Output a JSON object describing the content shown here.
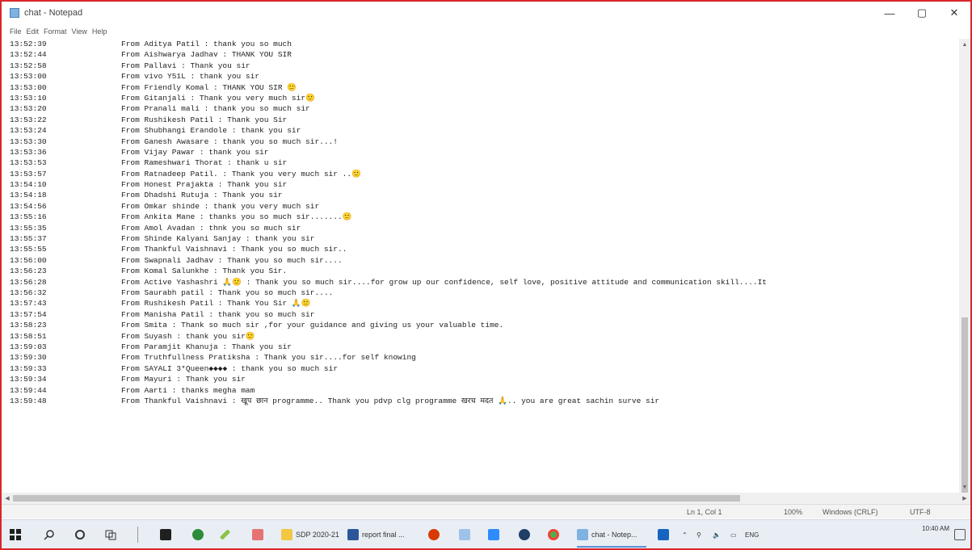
{
  "window": {
    "title": "chat - Notepad",
    "controls": {
      "minimize": "—",
      "maximize": "▢",
      "close": "✕"
    }
  },
  "menu": [
    "File",
    "Edit",
    "Format",
    "View",
    "Help"
  ],
  "chat_lines": [
    {
      "time": "13:52:39",
      "text": "From  Aditya Patil : thank you so much"
    },
    {
      "time": "13:52:44",
      "text": "From  Aishwarya Jadhav : THANK YOU SIR"
    },
    {
      "time": "13:52:58",
      "text": "From  Pallavi : Thank you sir"
    },
    {
      "time": "13:53:00",
      "text": "From  vivo Y51L : thank you sir"
    },
    {
      "time": "13:53:00",
      "text": "From  Friendly Komal : THANK YOU SIR 🙂"
    },
    {
      "time": "13:53:10",
      "text": "From  Gitanjali : Thank you very much sir🙂"
    },
    {
      "time": "13:53:20",
      "text": "From  Pranali mali : thank you so much sir"
    },
    {
      "time": "13:53:22",
      "text": "From  Rushikesh Patil : Thank you Sir"
    },
    {
      "time": "13:53:24",
      "text": "From  Shubhangi Erandole : thank you sir"
    },
    {
      "time": "13:53:30",
      "text": "From  Ganesh Awasare : thank you so much sir...!"
    },
    {
      "time": "13:53:36",
      "text": "From  Vijay Pawar : thank you sir"
    },
    {
      "time": "13:53:53",
      "text": "From  Rameshwari Thorat : thank u sir"
    },
    {
      "time": "13:53:57",
      "text": "From  Ratnadeep Patil. : Thank you very much sir  ..🙂"
    },
    {
      "time": "13:54:10",
      "text": "From  Honest Prajakta : Thank you sir"
    },
    {
      "time": "13:54:18",
      "text": "From  Dhadshi Rutuja : Thank you sir"
    },
    {
      "time": "13:54:56",
      "text": "From  Omkar shinde : thank you very much sir"
    },
    {
      "time": "13:55:16",
      "text": "From  Ankita Mane : thanks you so much sir.......🙂"
    },
    {
      "time": "13:55:35",
      "text": "From  Amol Avadan : thnk you so much sir"
    },
    {
      "time": "13:55:37",
      "text": "From  Shinde Kalyani Sanjay : thank you sir"
    },
    {
      "time": "13:55:55",
      "text": "From  Thankful Vaishnavi : Thank you so much sir.."
    },
    {
      "time": "13:56:00",
      "text": "From  Swapnali Jadhav : Thank you so much sir...."
    },
    {
      "time": "13:56:23",
      "text": "From  Komal  Salunkhe : Thank you Sir."
    },
    {
      "time": "13:56:28",
      "text": "From  Active Yashashri 🙏🙂 : Thank you so much sir....for grow up our confidence, self love, positive attitude and communication skill....It"
    },
    {
      "time": "13:56:32",
      "text": "From  Saurabh patil : Thank you so much sir...."
    },
    {
      "time": "13:57:43",
      "text": "From  Rushikesh Patil : Thank You Sir 🙏🙂"
    },
    {
      "time": "13:57:54",
      "text": "From  Manisha Patil : thank you so much sir"
    },
    {
      "time": "13:58:23",
      "text": "From  Smita : Thank so much sir ,for your guidance and giving us your valuable time."
    },
    {
      "time": "13:58:51",
      "text": "From  Suyash : thank you sir🙂"
    },
    {
      "time": "13:59:03",
      "text": "From  Paramjit Khanuja : Thank you sir"
    },
    {
      "time": "13:59:30",
      "text": "From  Truthfullness Pratiksha : Thank you sir....for self knowing"
    },
    {
      "time": "13:59:33",
      "text": "From  SAYALI 3*Queen◆◆◆◆ : thank you so much sir"
    },
    {
      "time": "13:59:34",
      "text": "From  Mayuri : Thank you sir"
    },
    {
      "time": "13:59:44",
      "text": "From  Aarti : thanks megha mam"
    },
    {
      "time": "13:59:48",
      "text": "From  Thankful Vaishnavi : खूप छान programme.. Thank you pdvp clg programme खरच मदत 🙏.. you are great sachin surve sir"
    }
  ],
  "status": {
    "position": "Ln 1, Col 1",
    "zoom": "100%",
    "line_ending": "Windows (CRLF)",
    "encoding": "UTF-8"
  },
  "taskbar": {
    "sdp_label": "SDP 2020-21",
    "report_label": "report final ...",
    "notepad_label": "chat - Notep...",
    "lang": "ENG",
    "time": "10:40 AM"
  },
  "colors": {
    "frame_border": "#d9262b",
    "taskbar_bg": "#e9eef5",
    "accent": "#5b8ed6"
  },
  "icons": {
    "app": "notepad-icon",
    "start": "windows-start-icon",
    "search": "search-icon",
    "cortana": "cortana-circle-icon",
    "task_view": "task-view-icon"
  }
}
